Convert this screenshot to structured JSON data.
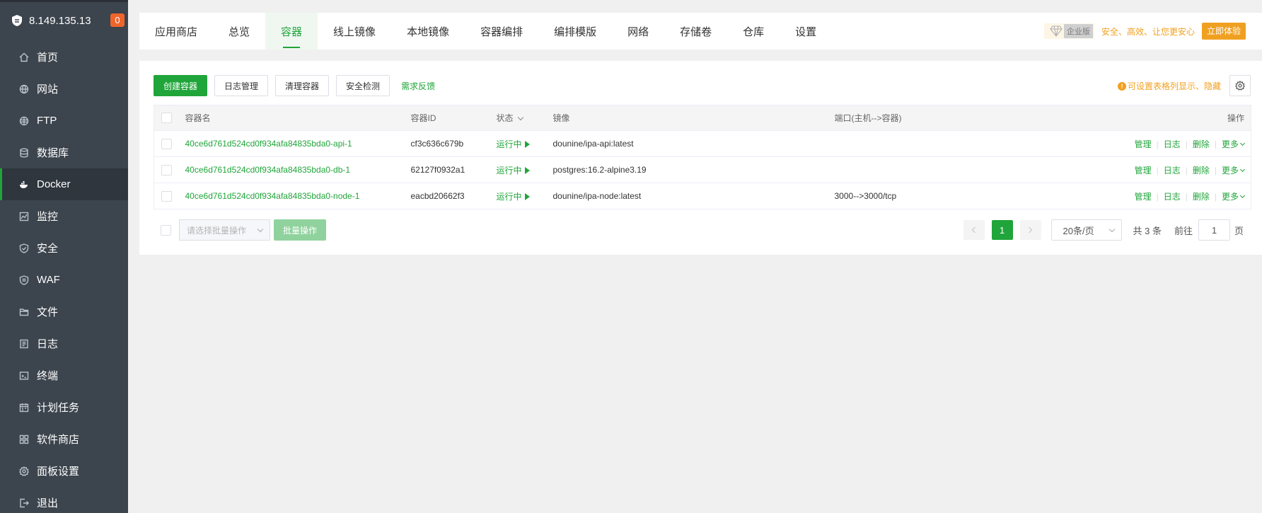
{
  "server": {
    "ip": "8.149.135.13",
    "notifications": "0"
  },
  "sidebar": {
    "items": [
      {
        "label": "首页",
        "icon": "home-icon"
      },
      {
        "label": "网站",
        "icon": "globe-icon"
      },
      {
        "label": "FTP",
        "icon": "ftp-icon"
      },
      {
        "label": "数据库",
        "icon": "database-icon"
      },
      {
        "label": "Docker",
        "icon": "docker-icon"
      },
      {
        "label": "监控",
        "icon": "monitor-icon"
      },
      {
        "label": "安全",
        "icon": "shield-icon"
      },
      {
        "label": "WAF",
        "icon": "waf-icon"
      },
      {
        "label": "文件",
        "icon": "folder-icon"
      },
      {
        "label": "日志",
        "icon": "log-icon"
      },
      {
        "label": "终端",
        "icon": "terminal-icon"
      },
      {
        "label": "计划任务",
        "icon": "calendar-icon"
      },
      {
        "label": "软件商店",
        "icon": "apps-icon"
      },
      {
        "label": "面板设置",
        "icon": "gear-icon"
      },
      {
        "label": "退出",
        "icon": "logout-icon"
      }
    ],
    "active": "Docker"
  },
  "tabs": [
    "应用商店",
    "总览",
    "容器",
    "线上镜像",
    "本地镜像",
    "容器编排",
    "编排模版",
    "网络",
    "存储卷",
    "仓库",
    "设置"
  ],
  "active_tab": "容器",
  "promo": {
    "edition": "企业版",
    "slogan": "安全、高效、让您更安心",
    "try_label": "立即体验"
  },
  "toolbar": {
    "create": "创建容器",
    "logs": "日志管理",
    "clean": "清理容器",
    "security": "安全检测",
    "feedback": "需求反馈",
    "hint": "可设置表格列显示、隐藏"
  },
  "table": {
    "headers": {
      "name": "容器名",
      "id": "容器ID",
      "status": "状态",
      "image": "镜像",
      "port": "端口(主机-->容器)",
      "ops": "操作"
    },
    "rows": [
      {
        "name": "40ce6d761d524cd0f934afa84835bda0-api-1",
        "id": "cf3c636c679b",
        "status": "运行中",
        "image": "dounine/ipa-api:latest",
        "port": ""
      },
      {
        "name": "40ce6d761d524cd0f934afa84835bda0-db-1",
        "id": "62127f0932a1",
        "status": "运行中",
        "image": "postgres:16.2-alpine3.19",
        "port": ""
      },
      {
        "name": "40ce6d761d524cd0f934afa84835bda0-node-1",
        "id": "eacbd20662f3",
        "status": "运行中",
        "image": "dounine/ipa-node:latest",
        "port": "3000-->3000/tcp"
      }
    ],
    "ops": {
      "manage": "管理",
      "log": "日志",
      "delete": "删除",
      "more": "更多"
    }
  },
  "footer": {
    "batch_placeholder": "请选择批量操作",
    "batch_button": "批量操作",
    "current_page": "1",
    "page_size": "20条/页",
    "total": "共 3 条",
    "goto_label": "前往",
    "goto_value": "1",
    "page_unit": "页"
  },
  "colors": {
    "accent": "#20a53a",
    "sidebar": "#3c444d",
    "warning": "#f0a020",
    "badge": "#f0652b"
  }
}
